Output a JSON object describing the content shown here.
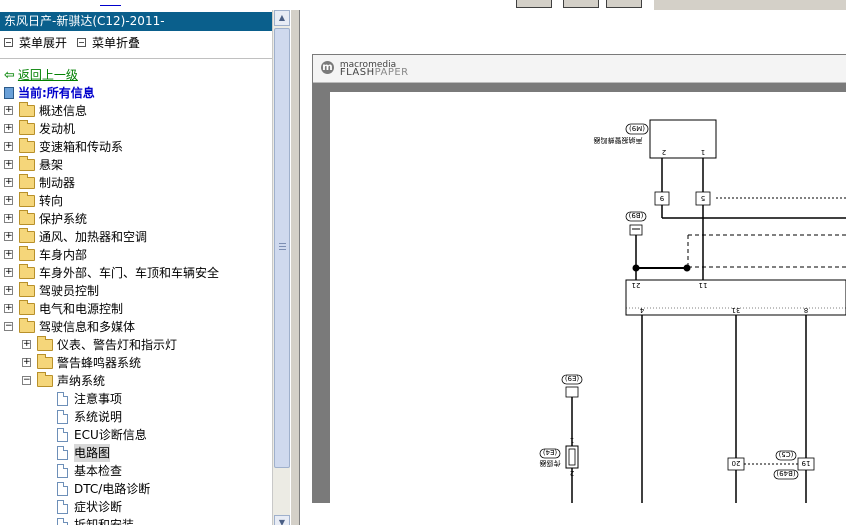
{
  "top": {
    "link_text": "        "
  },
  "left_panel": {
    "title": "东风日产-新骐达(C12)-2011-",
    "menu": {
      "expand_all": "菜单展开",
      "collapse_all": "菜单折叠"
    },
    "back_label": "返回上一级",
    "current_label": "当前:所有信息",
    "tree": [
      {
        "label": "概述信息",
        "level": 0,
        "type": "folder",
        "exp": "+"
      },
      {
        "label": "发动机",
        "level": 0,
        "type": "folder",
        "exp": "+"
      },
      {
        "label": "变速箱和传动系",
        "level": 0,
        "type": "folder",
        "exp": "+"
      },
      {
        "label": "悬架",
        "level": 0,
        "type": "folder",
        "exp": "+"
      },
      {
        "label": "制动器",
        "level": 0,
        "type": "folder",
        "exp": "+"
      },
      {
        "label": "转向",
        "level": 0,
        "type": "folder",
        "exp": "+"
      },
      {
        "label": "保护系统",
        "level": 0,
        "type": "folder",
        "exp": "+"
      },
      {
        "label": "通风、加热器和空调",
        "level": 0,
        "type": "folder",
        "exp": "+"
      },
      {
        "label": "车身内部",
        "level": 0,
        "type": "folder",
        "exp": "+"
      },
      {
        "label": "车身外部、车门、车顶和车辆安全",
        "level": 0,
        "type": "folder",
        "exp": "+"
      },
      {
        "label": "驾驶员控制",
        "level": 0,
        "type": "folder",
        "exp": "+"
      },
      {
        "label": "电气和电源控制",
        "level": 0,
        "type": "folder",
        "exp": "+"
      },
      {
        "label": "驾驶信息和多媒体",
        "level": 0,
        "type": "folder",
        "exp": "-"
      },
      {
        "label": "仪表、警告灯和指示灯",
        "level": 1,
        "type": "folder",
        "exp": "+"
      },
      {
        "label": "警告蜂鸣器系统",
        "level": 1,
        "type": "folder",
        "exp": "+"
      },
      {
        "label": "声纳系统",
        "level": 1,
        "type": "folder",
        "exp": "-"
      },
      {
        "label": "注意事项",
        "level": 2,
        "type": "doc"
      },
      {
        "label": "系统说明",
        "level": 2,
        "type": "doc"
      },
      {
        "label": "ECU诊断信息",
        "level": 2,
        "type": "doc"
      },
      {
        "label": "电路图",
        "level": 2,
        "type": "doc",
        "selected": true
      },
      {
        "label": "基本检查",
        "level": 2,
        "type": "doc"
      },
      {
        "label": "DTC/电路诊断",
        "level": 2,
        "type": "doc"
      },
      {
        "label": "症状诊断",
        "level": 2,
        "type": "doc"
      },
      {
        "label": "拆卸和安装",
        "level": 2,
        "type": "doc"
      }
    ]
  },
  "viewer": {
    "logo_top": "macromedia",
    "logo_flash": "FLASH",
    "logo_paper": "PAPER",
    "diagram": {
      "connector_top": "(M9)",
      "component_label": "声纳报警蜂鸣器",
      "pin_top_left": "2",
      "pin_top_right": "1",
      "pin_mid_left": "9",
      "pin_mid_right": "5",
      "ground_label": "(B9)",
      "pin_row_a": "21",
      "pin_row_b": "11",
      "pin_bottom_left": "4",
      "pin_bottom_mid": "31",
      "pin_bottom_right": "8",
      "connector_left": "(E9)",
      "connector_left2": "(E4)",
      "sensor_label": "传感器",
      "pin_sensor_top": "1",
      "pin_sensor_bottom": "2",
      "pin_right_a": "20",
      "pin_right_b": "19",
      "connector_right_a": "(C5)",
      "connector_right_b": "(B49)"
    }
  }
}
